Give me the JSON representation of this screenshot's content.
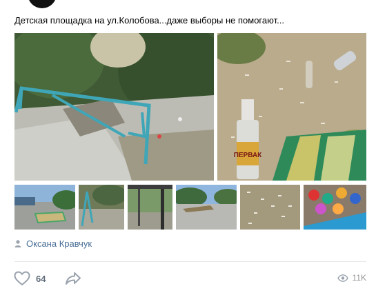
{
  "post": {
    "text": "Детская площадка на ул.Колобова...даже выборы не помогают..."
  },
  "photos": {
    "main": [
      {
        "description_icon": "photo-broken-bench"
      },
      {
        "description_icon": "photo-bottle-litter"
      }
    ],
    "thumbnails_count": 6,
    "bottle_label": "ПЕРВАК"
  },
  "author": {
    "icon": "person-icon",
    "name": "Оксана Кравчук"
  },
  "actions": {
    "like_icon": "heart-icon",
    "like_count": "64",
    "share_icon": "share-arrow-icon"
  },
  "stats": {
    "views_icon": "eye-icon",
    "views_count": "11K"
  },
  "colors": {
    "link": "#4a6e96",
    "muted": "#939393",
    "icon": "#99a2ad",
    "divider": "#e7e8ec"
  }
}
